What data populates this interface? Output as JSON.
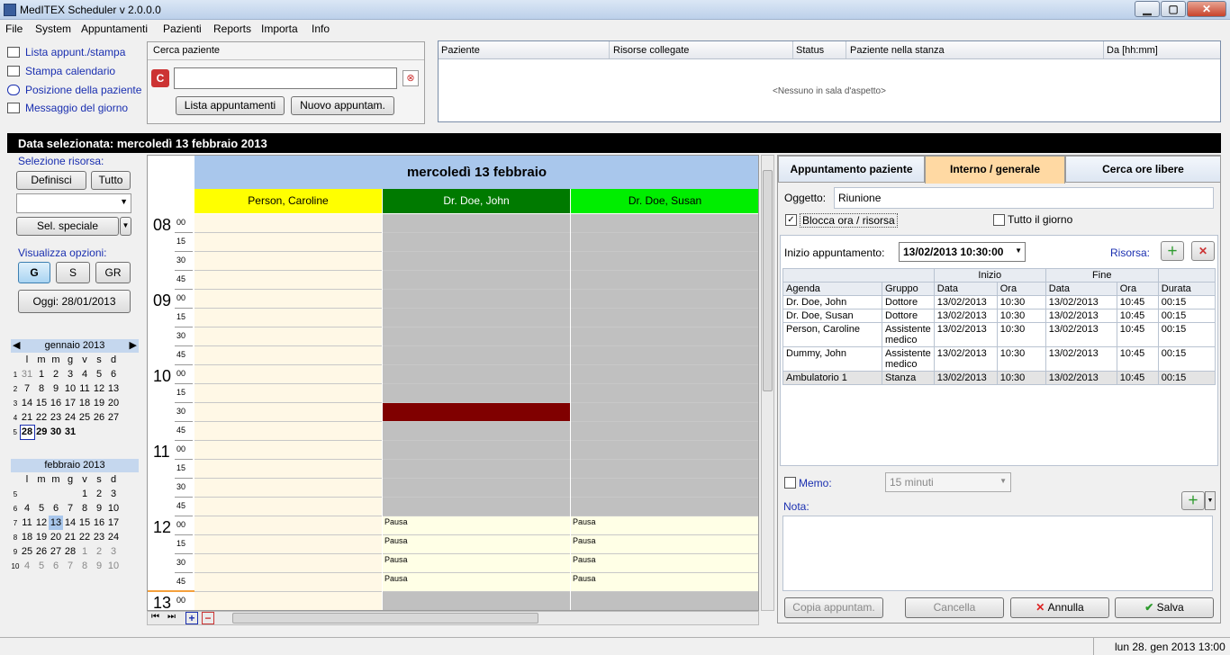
{
  "window": {
    "title": "MedITEX  Scheduler v 2.0.0.0",
    "min": "▁",
    "max": "▢",
    "close": "✕"
  },
  "menu": [
    "File",
    "System",
    "Appuntamenti",
    "Pazienti",
    "Reports",
    "Importa",
    "Info"
  ],
  "quicklinks": [
    "Lista appunt./stampa",
    "Stampa calendario",
    "Posizione della paziente",
    "Messaggio del giorno"
  ],
  "search": {
    "title": "Cerca paziente",
    "value": "",
    "list_btn": "Lista appuntamenti",
    "new_btn": "Nuovo appuntam."
  },
  "waiting": {
    "columns": [
      "Paziente",
      "Risorse collegate",
      "Status",
      "Paziente nella stanza",
      "Da [hh:mm]"
    ],
    "empty": "<Nessuno in sala d'aspetto>"
  },
  "datebar": "Data selezionata: mercoledì 13 febbraio 2013",
  "left": {
    "resource_label": "Selezione risorsa:",
    "define": "Definisci",
    "all": "Tutto",
    "special": "Sel. speciale",
    "view_label": "Visualizza opzioni:",
    "views": [
      "G",
      "S",
      "GR"
    ],
    "today": "Oggi: 28/01/2013"
  },
  "cal_jan": {
    "title": "gennaio 2013",
    "days": [
      "l",
      "m",
      "m",
      "g",
      "v",
      "s",
      "d"
    ],
    "weeks": [
      {
        "n": "1",
        "d": [
          "31",
          "1",
          "2",
          "3",
          "4",
          "5",
          "6"
        ]
      },
      {
        "n": "2",
        "d": [
          "7",
          "8",
          "9",
          "10",
          "11",
          "12",
          "13"
        ]
      },
      {
        "n": "3",
        "d": [
          "14",
          "15",
          "16",
          "17",
          "18",
          "19",
          "20"
        ]
      },
      {
        "n": "4",
        "d": [
          "21",
          "22",
          "23",
          "24",
          "25",
          "26",
          "27"
        ]
      },
      {
        "n": "5",
        "d": [
          "28",
          "29",
          "30",
          "31",
          "",
          "",
          ""
        ]
      }
    ]
  },
  "cal_feb": {
    "title": "febbraio 2013",
    "days": [
      "l",
      "m",
      "m",
      "g",
      "v",
      "s",
      "d"
    ],
    "weeks": [
      {
        "n": "5",
        "d": [
          "",
          "",
          "",
          "",
          "1",
          "2",
          "3"
        ]
      },
      {
        "n": "6",
        "d": [
          "4",
          "5",
          "6",
          "7",
          "8",
          "9",
          "10"
        ]
      },
      {
        "n": "7",
        "d": [
          "11",
          "12",
          "13",
          "14",
          "15",
          "16",
          "17"
        ]
      },
      {
        "n": "8",
        "d": [
          "18",
          "19",
          "20",
          "21",
          "22",
          "23",
          "24"
        ]
      },
      {
        "n": "9",
        "d": [
          "25",
          "26",
          "27",
          "28",
          "1",
          "2",
          "3"
        ]
      },
      {
        "n": "10",
        "d": [
          "4",
          "5",
          "6",
          "7",
          "8",
          "9",
          "10"
        ]
      }
    ]
  },
  "grid": {
    "day_header": "mercoledì 13 febbraio",
    "resources": [
      {
        "name": "Person, Caroline",
        "color": "#ffff00",
        "text": "#000000"
      },
      {
        "name": "Dr. Doe, John",
        "color": "#007a00",
        "text": "#ffffff"
      },
      {
        "name": "Dr. Doe, Susan",
        "color": "#00ee00",
        "text": "#000000"
      }
    ],
    "hours": [
      "08",
      "09",
      "10",
      "11",
      "12",
      "13"
    ],
    "minutes": [
      "00",
      "15",
      "30",
      "45"
    ],
    "pause_label": "Pausa"
  },
  "right": {
    "tabs": [
      "Appuntamento paziente",
      "Interno / generale",
      "Cerca ore libere"
    ],
    "subject_label": "Oggetto:",
    "subject_value": "Riunione",
    "block_label": "Blocca ora / risorsa",
    "allday_label": "Tutto il giorno",
    "start_label": "Inizio appuntamento:",
    "start_value": "13/02/2013 10:30:00",
    "resource_label": "Risorsa:",
    "table": {
      "group_headers": [
        "Inizio",
        "Fine"
      ],
      "headers": [
        "Agenda",
        "Gruppo",
        "Data",
        "Ora",
        "Data",
        "Ora",
        "Durata"
      ],
      "rows": [
        [
          "Dr. Doe, John",
          "Dottore",
          "13/02/2013",
          "10:30",
          "13/02/2013",
          "10:45",
          "00:15"
        ],
        [
          "Dr. Doe, Susan",
          "Dottore",
          "13/02/2013",
          "10:30",
          "13/02/2013",
          "10:45",
          "00:15"
        ],
        [
          "Person, Caroline",
          "Assistente medico",
          "13/02/2013",
          "10:30",
          "13/02/2013",
          "10:45",
          "00:15"
        ],
        [
          "Dummy, John",
          "Assistente medico",
          "13/02/2013",
          "10:30",
          "13/02/2013",
          "10:45",
          "00:15"
        ],
        [
          "Ambulatorio 1",
          "Stanza",
          "13/02/2013",
          "10:30",
          "13/02/2013",
          "10:45",
          "00:15"
        ]
      ]
    },
    "memo_label": "Memo:",
    "memo_value": "15 minuti",
    "note_label": "Nota:",
    "copy_btn": "Copia appuntam.",
    "delete_btn": "Cancella",
    "cancel_btn": "Annulla",
    "save_btn": "Salva"
  },
  "status": "lun 28. gen 2013 13:00"
}
